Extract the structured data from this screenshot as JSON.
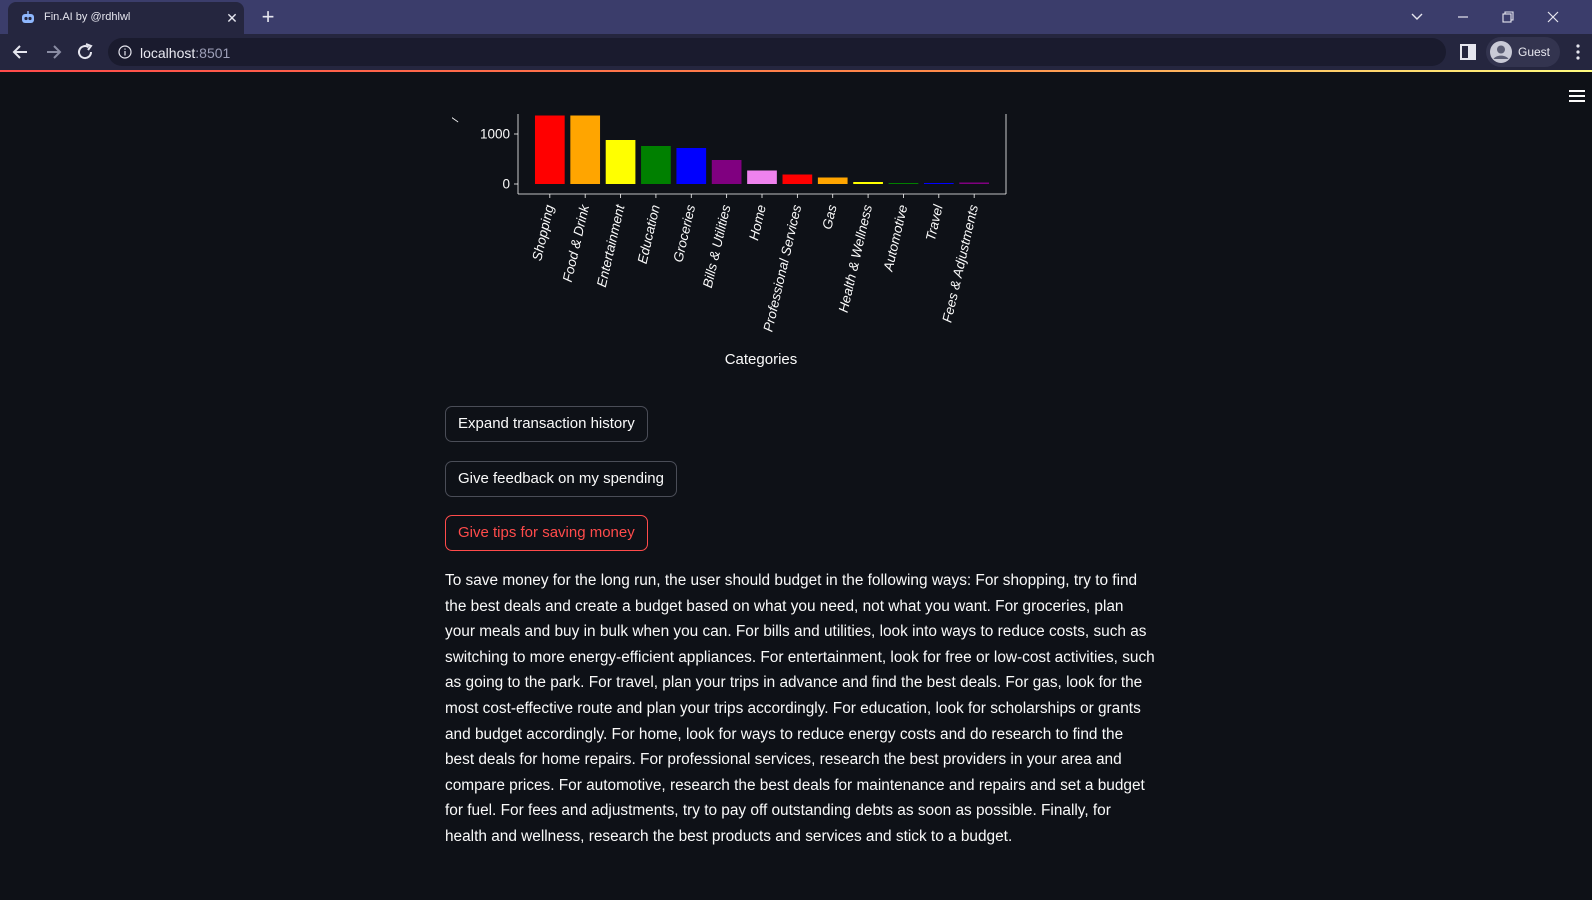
{
  "browser": {
    "tab_title": "Fin.AI by @rdhlwl",
    "url_host": "localhost",
    "url_port": ":8501",
    "profile_label": "Guest"
  },
  "app": {
    "buttons": {
      "expand": "Expand transaction history",
      "feedback": "Give feedback on my spending",
      "tips": "Give tips for saving money"
    },
    "tips_text": "To save money for the long run, the user should budget in the following ways: For shopping, try to find the best deals and create a budget based on what you need, not what you want. For groceries, plan your meals and buy in bulk when you can. For bills and utilities, look into ways to reduce costs, such as switching to more energy-efficient appliances. For entertainment, look for free or low-cost activities, such as going to the park. For travel, plan your trips in advance and find the best deals. For gas, look for the most cost-effective route and plan your trips accordingly. For education, look for scholarships or grants and budget accordingly. For home, look for ways to reduce energy costs and do research to find the best deals for home repairs. For professional services, research the best providers in your area and compare prices. For automotive, research the best deals for maintenance and repairs and set a budget for fuel. For fees and adjustments, try to pay off outstanding debts as soon as possible. Finally, for health and wellness, research the best products and services and stick to a budget."
  },
  "colors": {
    "page_bg": "#0e1117",
    "accent": "#ff4b4b"
  },
  "chart_data": {
    "type": "bar",
    "xlabel": "Categories",
    "ylabel_fragment": "/",
    "categories": [
      "Shopping",
      "Food & Drink",
      "Entertainment",
      "Education",
      "Groceries",
      "Bills & Utilities",
      "Home",
      "Professional Services",
      "Gas",
      "Health & Wellness",
      "Automotive",
      "Travel",
      "Fees & Adjustments"
    ],
    "values": [
      1370,
      1370,
      880,
      760,
      720,
      480,
      270,
      190,
      130,
      40,
      20,
      20,
      30
    ],
    "colors": [
      "#ff0000",
      "#ffa500",
      "#ffff00",
      "#008000",
      "#0000ff",
      "#800080",
      "#ee82ee",
      "#ff0000",
      "#ffa500",
      "#ffff00",
      "#008000",
      "#0000ff",
      "#800080"
    ],
    "yticks": [
      0,
      1000
    ],
    "ylim": [
      -200,
      1400
    ],
    "grid": false,
    "legend": "none"
  }
}
